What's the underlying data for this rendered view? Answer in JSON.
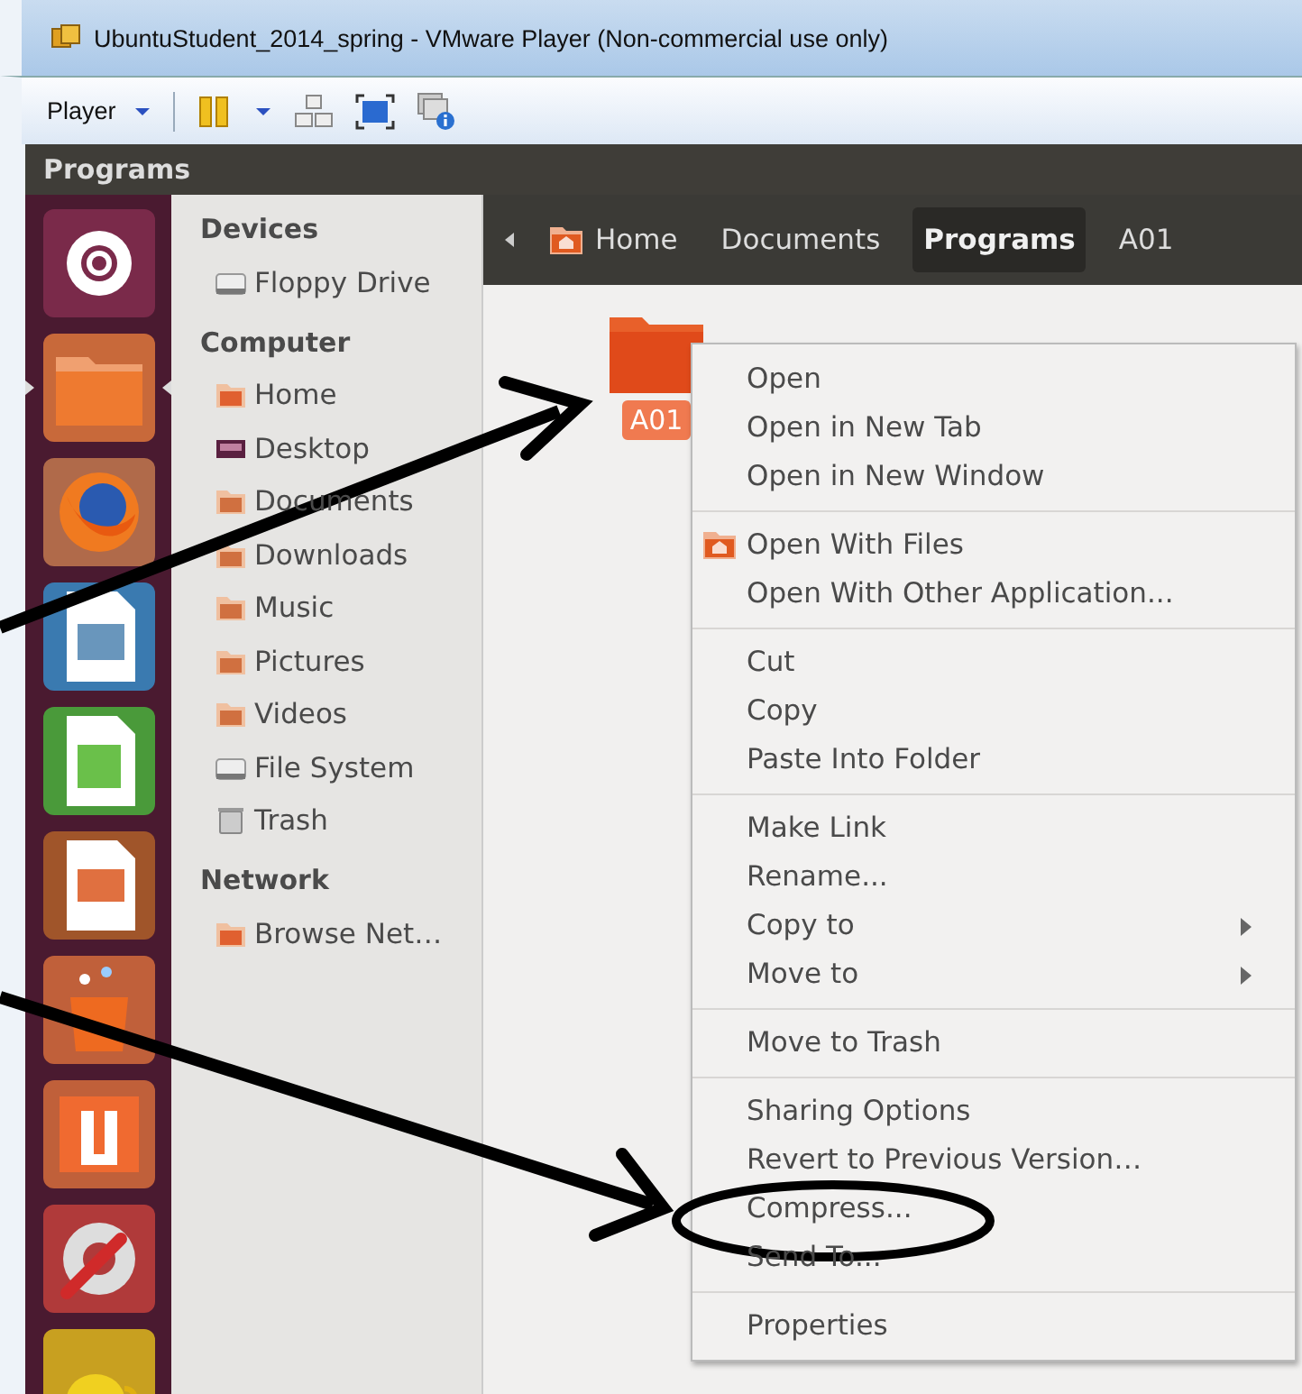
{
  "window": {
    "title": "UbuntuStudent_2014_spring - VMware Player (Non-commercial use only)"
  },
  "toolbar": {
    "player_menu": "Player"
  },
  "app_title": "Programs",
  "launcher": [
    {
      "kind": "ubuntu",
      "active": false
    },
    {
      "kind": "files",
      "active": true
    },
    {
      "kind": "browser",
      "active": false
    },
    {
      "kind": "writer",
      "active": false
    },
    {
      "kind": "calc",
      "active": false
    },
    {
      "kind": "impress",
      "active": false
    },
    {
      "kind": "store",
      "active": false
    },
    {
      "kind": "u",
      "active": false
    },
    {
      "kind": "settings",
      "active": false
    },
    {
      "kind": "teapot",
      "active": false
    }
  ],
  "sidebar": [
    {
      "heading": "Devices",
      "items": [
        {
          "label": "Floppy Drive",
          "kind": "drive"
        }
      ]
    },
    {
      "heading": "Computer",
      "items": [
        {
          "label": "Home",
          "kind": "home"
        },
        {
          "label": "Desktop",
          "kind": "desktop"
        },
        {
          "label": "Documents",
          "kind": "folder"
        },
        {
          "label": "Downloads",
          "kind": "folder"
        },
        {
          "label": "Music",
          "kind": "folder"
        },
        {
          "label": "Pictures",
          "kind": "folder"
        },
        {
          "label": "Videos",
          "kind": "folder"
        },
        {
          "label": "File System",
          "kind": "drive"
        },
        {
          "label": "Trash",
          "kind": "trash"
        }
      ]
    },
    {
      "heading": "Network",
      "items": [
        {
          "label": "Browse Net…",
          "kind": "home"
        }
      ]
    }
  ],
  "breadcrumb": [
    {
      "label": "Home",
      "selected": false,
      "kind": "home"
    },
    {
      "label": "Documents",
      "selected": false,
      "kind": "plain"
    },
    {
      "label": "Programs",
      "selected": true,
      "kind": "plain"
    },
    {
      "label": "A01",
      "selected": false,
      "kind": "plain"
    }
  ],
  "folder": {
    "label": "A01"
  },
  "context_menu": [
    [
      {
        "label": "Open",
        "kind": "plain"
      },
      {
        "label": "Open in New Tab",
        "kind": "plain"
      },
      {
        "label": "Open in New Window",
        "kind": "plain"
      }
    ],
    [
      {
        "label": "Open With Files",
        "kind": "icon"
      },
      {
        "label": "Open With Other Application...",
        "kind": "plain"
      }
    ],
    [
      {
        "label": "Cut",
        "kind": "plain"
      },
      {
        "label": "Copy",
        "kind": "plain"
      },
      {
        "label": "Paste Into Folder",
        "kind": "plain"
      }
    ],
    [
      {
        "label": "Make Link",
        "kind": "plain"
      },
      {
        "label": "Rename...",
        "kind": "plain"
      },
      {
        "label": "Copy to",
        "kind": "submenu"
      },
      {
        "label": "Move to",
        "kind": "submenu"
      }
    ],
    [
      {
        "label": "Move to Trash",
        "kind": "plain"
      }
    ],
    [
      {
        "label": "Sharing Options",
        "kind": "plain"
      },
      {
        "label": "Revert to Previous Version…",
        "kind": "plain"
      },
      {
        "label": "Compress...",
        "kind": "plain"
      },
      {
        "label": "Send To...",
        "kind": "plain"
      }
    ],
    [
      {
        "label": "Properties",
        "kind": "plain"
      }
    ]
  ]
}
